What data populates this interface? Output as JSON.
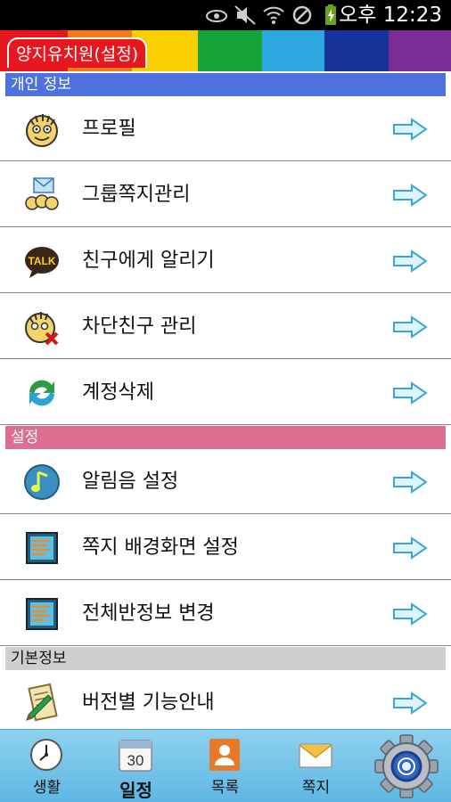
{
  "status_bar": {
    "time": "12:23",
    "ampm": "오후"
  },
  "header": {
    "title": "양지유치원(설정)"
  },
  "sections": {
    "personal": "개인 정보",
    "settings": "설정",
    "basic": "기본정보"
  },
  "rows": {
    "profile": "프로필",
    "group_note": "그룹쪽지관리",
    "tell_friends": "친구에게 알리기",
    "blocked": "차단친구 관리",
    "delete_account": "계정삭제",
    "notification_sound": "알림음 설정",
    "note_background": "쪽지 배경화면 설정",
    "class_info": "전체반정보 변경",
    "version_guide": "버전별 기능안내"
  },
  "tabs": {
    "life": "생활",
    "schedule": "일정",
    "calendar_day": "30",
    "list": "목록",
    "note": "쪽지"
  },
  "icons": {
    "talk_badge": "TALK"
  },
  "colors": {
    "section_blue": "#4d72dd",
    "section_pink": "#dc6e8f",
    "section_gray": "#cfcfcf",
    "tab_bar": "#78c6ea"
  }
}
